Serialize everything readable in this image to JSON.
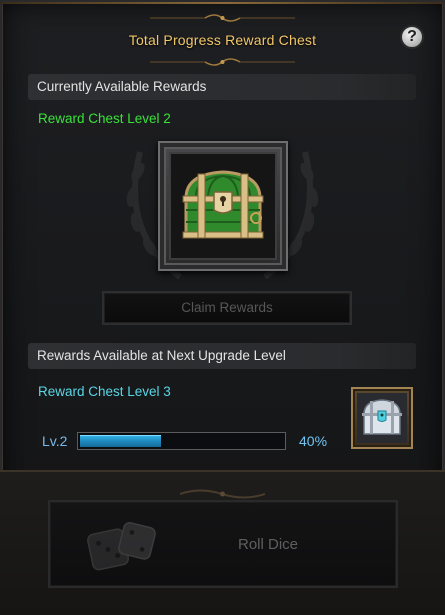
{
  "header": {
    "title": "Total Progress Reward Chest",
    "help_label": "?"
  },
  "current": {
    "section_label": "Currently Available Rewards",
    "level_label": "Reward Chest Level 2",
    "claim_label": "Claim Rewards"
  },
  "next": {
    "section_label": "Rewards Available at Next Upgrade Level",
    "level_label": "Reward Chest Level 3"
  },
  "progress": {
    "level_label": "Lv.2",
    "percent_label": "40%",
    "fraction": 0.4
  },
  "dice": {
    "label": "Roll Dice"
  },
  "icons": [
    "help-icon",
    "treasure-chest-icon",
    "laurel-wreath-icon",
    "silver-chest-icon",
    "dice-icon"
  ],
  "colors": {
    "title": "#f2c76a",
    "current_level": "#39e23a",
    "next_level": "#5ad6e6",
    "progress_fill": "#36b8e8"
  }
}
